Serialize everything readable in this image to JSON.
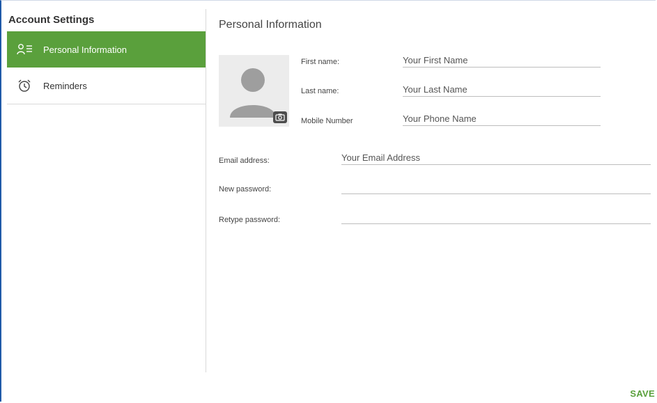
{
  "sidebar": {
    "title": "Account Settings",
    "items": [
      {
        "label": "Personal Information",
        "icon": "person-list-icon",
        "active": true
      },
      {
        "label": "Reminders",
        "icon": "alarm-clock-icon",
        "active": false
      }
    ]
  },
  "main": {
    "title": "Personal Information",
    "fields": {
      "first_name": {
        "label": "First name:",
        "placeholder": "Your First Name",
        "value": ""
      },
      "last_name": {
        "label": "Last name:",
        "placeholder": "Your Last Name",
        "value": ""
      },
      "mobile": {
        "label": "Mobile Number",
        "placeholder": "Your Phone Name",
        "value": ""
      },
      "email": {
        "label": "Email address:",
        "placeholder": "Your Email Address",
        "value": ""
      },
      "new_password": {
        "label": "New password:",
        "placeholder": "",
        "value": ""
      },
      "retype_password": {
        "label": "Retype password:",
        "placeholder": "",
        "value": ""
      }
    },
    "save_label": "SAVE"
  },
  "colors": {
    "accent": "#5aa03c",
    "frame_border": "#1f5aa8",
    "divider": "#d9d9d9"
  }
}
